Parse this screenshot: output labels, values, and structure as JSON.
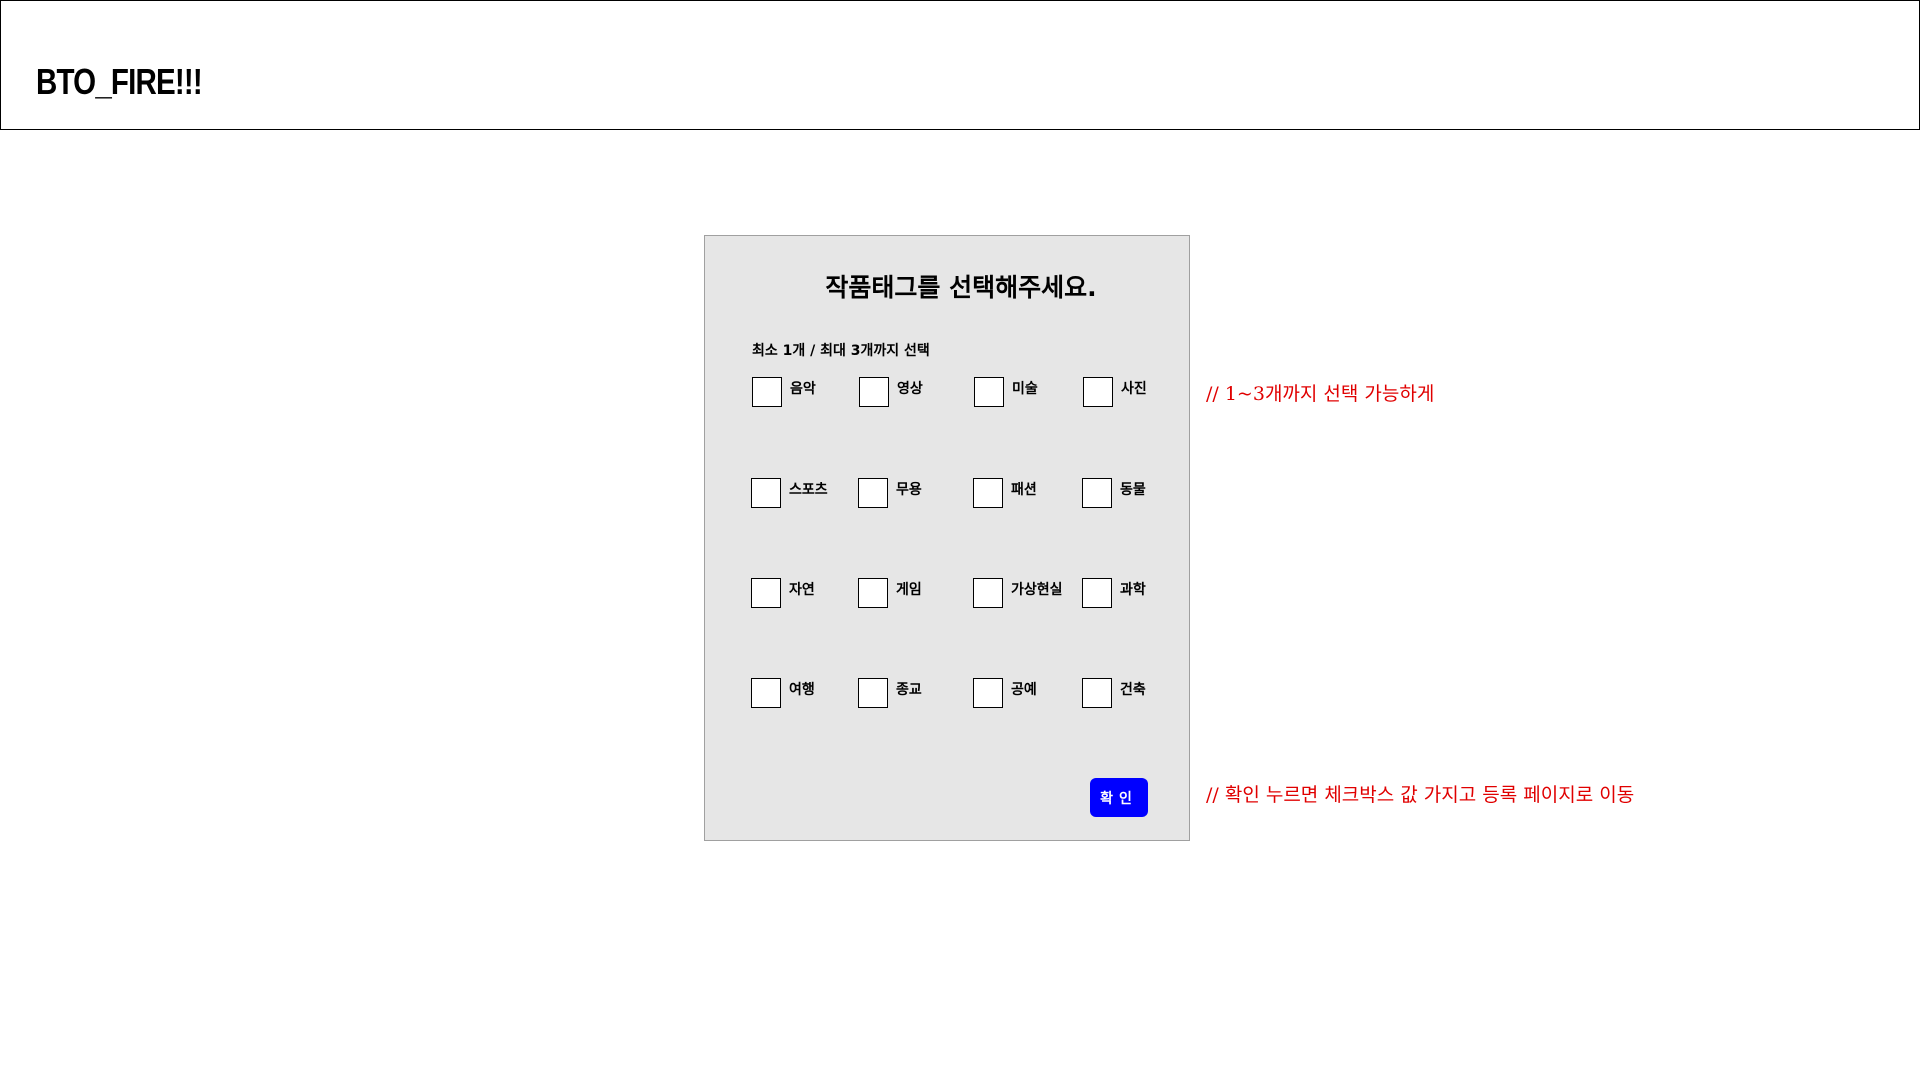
{
  "header": {
    "logo": "BTO_FIRE!!!"
  },
  "modal": {
    "title": "작품태그를 선택해주세요.",
    "instruction": "최소 1개 / 최대 3개까지 선택",
    "tags": [
      "음악",
      "영상",
      "미술",
      "사진",
      "스포츠",
      "무용",
      "패션",
      "동물",
      "자연",
      "게임",
      "가상현실",
      "과학",
      "여행",
      "종교",
      "공예",
      "건축"
    ],
    "confirm_label": "확인"
  },
  "notes": {
    "selection": "// 1~3개까지 선택 가능하게",
    "confirm": "// 확인 누르면 체크박스 값 가지고 등록 페이지로 이동"
  },
  "colors": {
    "modal_bg": "#e6e6e6",
    "confirm_button": "#0000ff",
    "note_text": "#e00000"
  }
}
